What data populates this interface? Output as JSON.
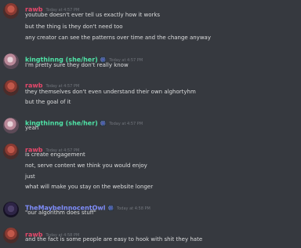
{
  "colors": {
    "rawb": "#e8486b",
    "kingthinng": "#4fe2a6",
    "owl": "#7f8dfa"
  },
  "messages": [
    {
      "author": "rawb",
      "timestamp": "Today at 4:57 PM",
      "lines": [
        "youtube doesn't ever tell us exactly how it works",
        "but the thing is they don't need too",
        "any creator can see the patterns over time and the change anyway"
      ]
    },
    {
      "author": "kingthinng (she/her)",
      "badge": "🎆",
      "timestamp": "Today at 4:57 PM",
      "lines": [
        "I'm pretty sure they don't really know"
      ]
    },
    {
      "author": "rawb",
      "timestamp": "Today at 4:57 PM",
      "lines": [
        "they themselves don't even understand their own alghortyhm",
        "but the goal of it"
      ]
    },
    {
      "author": "kingthinng (she/her)",
      "badge": "🎆",
      "timestamp": "Today at 4:57 PM",
      "lines": [
        "yeah"
      ]
    },
    {
      "author": "rawb",
      "timestamp": "Today at 4:57 PM",
      "lines": [
        "is create engagement",
        "not, serve content we think you would enjoy",
        "just",
        "what will make you stay on the website longer"
      ]
    },
    {
      "author": "TheMaybeInnocentOwl",
      "badge": "🎆",
      "timestamp": "Today at 4:58 PM",
      "lines": [
        "\"our algorithm does stuff\""
      ]
    },
    {
      "author": "rawb",
      "timestamp": "Today at 4:58 PM",
      "lines": [
        "and the fact is some people are easy to hook with shit they hate"
      ]
    }
  ]
}
